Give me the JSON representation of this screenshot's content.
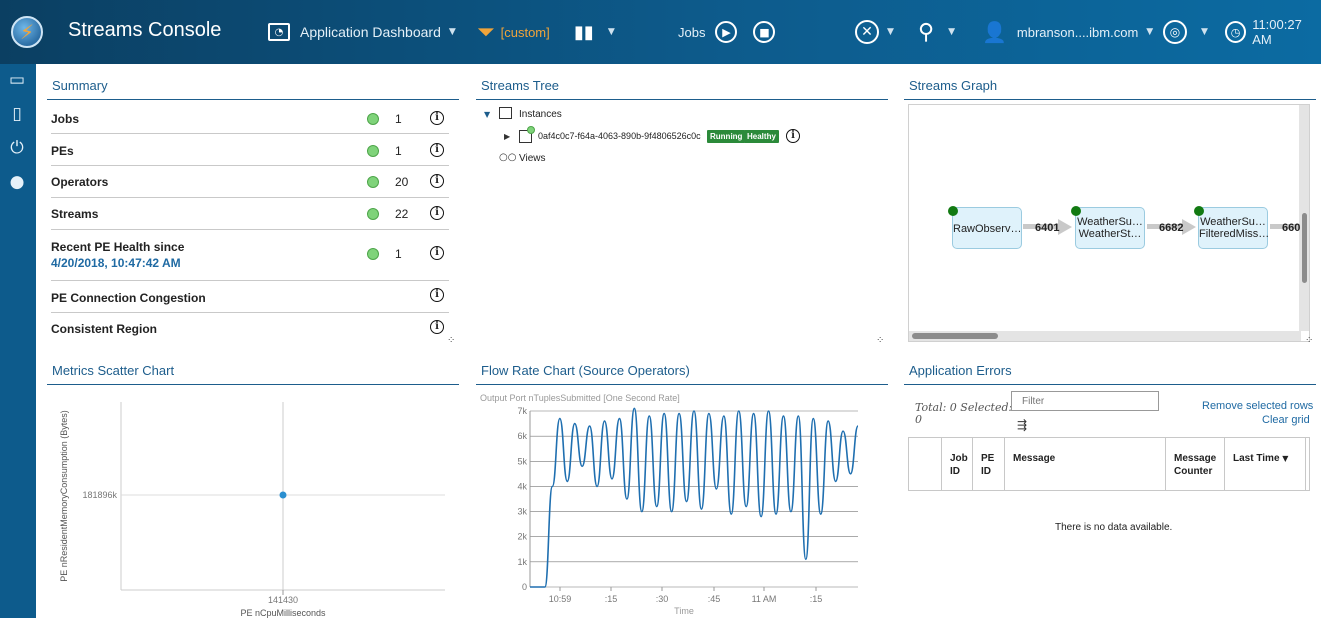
{
  "app": {
    "title": "Streams Console"
  },
  "toolbar": {
    "dashboard_label": "Application Dashboard",
    "filter_label": "[custom]",
    "jobs_label": "Jobs",
    "user_label": "mbranson....ibm.com",
    "time_label": "11:00:27 AM"
  },
  "summary": {
    "title": "Summary",
    "rows": [
      {
        "label": "Jobs",
        "count": "1"
      },
      {
        "label": "PEs",
        "count": "1"
      },
      {
        "label": "Operators",
        "count": "20"
      },
      {
        "label": "Streams",
        "count": "22"
      },
      {
        "label": "Recent PE Health since",
        "sub": "4/20/2018, 10:47:42 AM",
        "count": "1"
      },
      {
        "label": "PE Connection Congestion"
      },
      {
        "label": "Consistent Region"
      }
    ]
  },
  "tree": {
    "title": "Streams Tree",
    "instances_label": "Instances",
    "instance_id": "0af4c0c7-f64a-4063-890b-9f4806526c0c",
    "badge_running": "Running",
    "badge_healthy": "Healthy",
    "views_label": "Views"
  },
  "graph": {
    "title": "Streams Graph",
    "nodes": [
      {
        "line1": "RawObserv…",
        "line2": ""
      },
      {
        "line1": "WeatherSu…",
        "line2": "WeatherSt…"
      },
      {
        "line1": "WeatherSu…",
        "line2": "FilteredMiss…"
      }
    ],
    "flows": [
      "6401",
      "6682",
      "660"
    ]
  },
  "scatter": {
    "title": "Metrics Scatter Chart",
    "ylabel": "PE nResidentMemoryConsumption  (Bytes)",
    "xlabel": "PE nCpuMilliseconds",
    "ytick": "181896k",
    "xtick": "141430"
  },
  "flow_chart": {
    "title": "Flow Rate Chart (Source Operators)",
    "subtitle": "Output Port nTuplesSubmitted [One Second Rate]",
    "xlabel": "Time"
  },
  "errors": {
    "title": "Application Errors",
    "total_label": "Total: 0 Selected:",
    "total_value": "0",
    "filter_placeholder": "Filter",
    "remove_link": "Remove selected rows",
    "clear_link": "Clear grid",
    "columns": [
      "Job ID",
      "PE ID",
      "Message",
      "Message Counter",
      "Last Time"
    ],
    "no_data": "There is no data available."
  },
  "chart_data": [
    {
      "type": "scatter",
      "title": "Metrics Scatter Chart",
      "xlabel": "PE nCpuMilliseconds",
      "ylabel": "PE nResidentMemoryConsumption  (Bytes)",
      "x": [
        141430
      ],
      "y": [
        181896000
      ],
      "x_ticks": [
        "141430"
      ],
      "y_ticks": [
        "181896k"
      ],
      "grid": true
    },
    {
      "type": "line",
      "title": "Flow Rate Chart (Source Operators)",
      "subtitle": "Output Port nTuplesSubmitted [One Second Rate]",
      "xlabel": "Time",
      "x_ticks": [
        "10:59",
        ":15",
        ":30",
        ":45",
        "11 AM",
        ":15"
      ],
      "y_ticks": [
        "0",
        "1k",
        "2k",
        "3k",
        "4k",
        "5k",
        "6k",
        "7k"
      ],
      "ylim": [
        0,
        7000
      ],
      "grid": true,
      "series": [
        {
          "x": [
            0,
            1,
            2,
            3,
            4,
            5,
            6,
            7,
            8,
            9,
            10,
            11,
            12,
            13,
            14,
            15,
            16,
            17,
            18,
            19,
            20,
            21,
            22,
            23,
            24,
            25,
            26,
            27,
            28,
            29,
            30,
            31,
            32,
            33,
            34,
            35,
            36,
            37,
            38,
            39,
            40,
            41,
            42,
            43,
            44
          ],
          "values": [
            0,
            0,
            0,
            4000,
            6700,
            4200,
            6500,
            4800,
            6400,
            4000,
            6600,
            4300,
            6700,
            3500,
            7100,
            3000,
            6800,
            3200,
            6900,
            3000,
            6900,
            3400,
            7000,
            3100,
            6900,
            3900,
            6800,
            2900,
            7000,
            3200,
            6900,
            2800,
            7000,
            2900,
            6800,
            3000,
            6800,
            1100,
            6700,
            2900,
            6600,
            4200,
            6200,
            4500,
            6400
          ]
        }
      ]
    }
  ]
}
